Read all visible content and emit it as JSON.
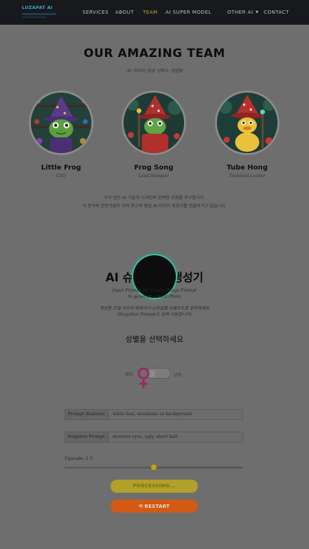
{
  "nav": {
    "logo_text": "LUZAPAT AI",
    "items": [
      {
        "label": "SERVICES"
      },
      {
        "label": "ABOUT"
      },
      {
        "label": "TEAM",
        "active": true
      },
      {
        "label": "AI SUPER MODEL"
      },
      {
        "label": "OTHER AI",
        "has_dropdown": true
      },
      {
        "label": "CONTACT"
      }
    ],
    "active_color": "#c9a227"
  },
  "team": {
    "title": "OUR AMAZING TEAM",
    "subtitle": "AI 이미지 생성 서비스 개발팀",
    "members": [
      {
        "name": "Little Frog",
        "role": "CEO",
        "avatar": "frog-wizard-purple-hat"
      },
      {
        "name": "Frog Song",
        "role": "Lead Designer",
        "avatar": "frog-wizard-red-hat"
      },
      {
        "name": "Tube Hong",
        "role": "Technical Leader",
        "avatar": "duck-wizard-red-hat"
      }
    ],
    "description_line1": "우리 팀은 AI 기술과 디자인의 완벽한 조화를 추구합니다.",
    "description_line2": "각 분야의 전문가들이 모여 최고의 품질 AI 이미지 생성기를 만들어가고 있습니다."
  },
  "generator": {
    "title": "AI 슈퍼 모델 생성기",
    "line1": "Input Prompt for Create Image Prompt",
    "line2": "to generate a Real Photo",
    "line3": "생성할 모델 사진의 배경이나 스타일을 프롬프트로 입력하세요",
    "line4": "(Negative Prompt도 입력 가능합니다)",
    "gender_question": "성별을 선택하세요",
    "gender_left": "여자",
    "gender_right": "남자",
    "female_color": "#9c2a5e",
    "prompt_label": "Prompt (feature)",
    "prompt_value": "white hair, mountain as background",
    "negative_label": "Negative Prompt",
    "negative_value": "monster eyes, ugly, short hair",
    "upscale_label": "Upscale: 1.5",
    "upscale_fraction": 0.5,
    "processing_label": "PROCESSING...",
    "restart_label": "RESTART",
    "processing_color": "#b1a029",
    "restart_color": "#d35a14",
    "spinner_color": "#33c2a2"
  }
}
